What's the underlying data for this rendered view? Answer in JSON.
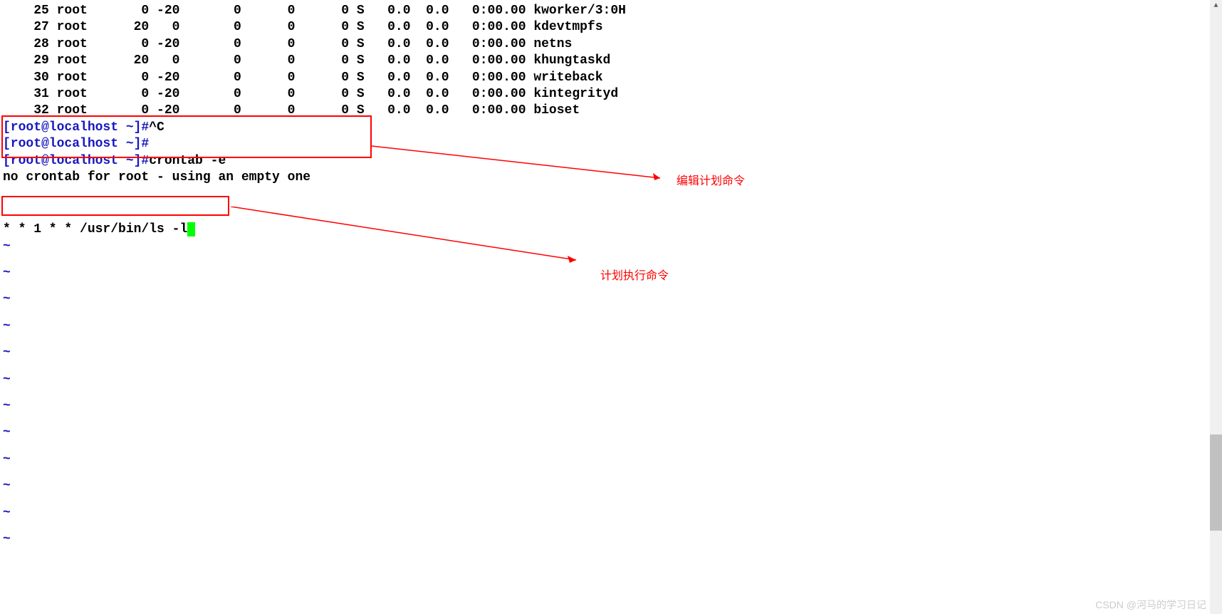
{
  "processes": [
    {
      "pid": "25",
      "user": "root",
      "pr": "0",
      "ni": "-20",
      "virt": "0",
      "res": "0",
      "shr": "0",
      "s": "S",
      "cpu": "0.0",
      "mem": "0.0",
      "time": "0:00.00",
      "command": "kworker/3:0H"
    },
    {
      "pid": "27",
      "user": "root",
      "pr": "20",
      "ni": "0",
      "virt": "0",
      "res": "0",
      "shr": "0",
      "s": "S",
      "cpu": "0.0",
      "mem": "0.0",
      "time": "0:00.00",
      "command": "kdevtmpfs"
    },
    {
      "pid": "28",
      "user": "root",
      "pr": "0",
      "ni": "-20",
      "virt": "0",
      "res": "0",
      "shr": "0",
      "s": "S",
      "cpu": "0.0",
      "mem": "0.0",
      "time": "0:00.00",
      "command": "netns"
    },
    {
      "pid": "29",
      "user": "root",
      "pr": "20",
      "ni": "0",
      "virt": "0",
      "res": "0",
      "shr": "0",
      "s": "S",
      "cpu": "0.0",
      "mem": "0.0",
      "time": "0:00.00",
      "command": "khungtaskd"
    },
    {
      "pid": "30",
      "user": "root",
      "pr": "0",
      "ni": "-20",
      "virt": "0",
      "res": "0",
      "shr": "0",
      "s": "S",
      "cpu": "0.0",
      "mem": "0.0",
      "time": "0:00.00",
      "command": "writeback"
    },
    {
      "pid": "31",
      "user": "root",
      "pr": "0",
      "ni": "-20",
      "virt": "0",
      "res": "0",
      "shr": "0",
      "s": "S",
      "cpu": "0.0",
      "mem": "0.0",
      "time": "0:00.00",
      "command": "kintegrityd"
    },
    {
      "pid": "32",
      "user": "root",
      "pr": "0",
      "ni": "-20",
      "virt": "0",
      "res": "0",
      "shr": "0",
      "s": "S",
      "cpu": "0.0",
      "mem": "0.0",
      "time": "0:00.00",
      "command": "bioset"
    }
  ],
  "prompt_text": "[root@localhost ~]#",
  "interrupt": "^C",
  "command1": "crontab -e",
  "response1": "no crontab for root - using an empty one",
  "crontab_entry": "* * 1 * * /usr/bin/ls -l",
  "tilde": "~",
  "annotation1": "编辑计划命令",
  "annotation2": "计划执行命令",
  "watermark": "CSDN @河马的学习日记"
}
